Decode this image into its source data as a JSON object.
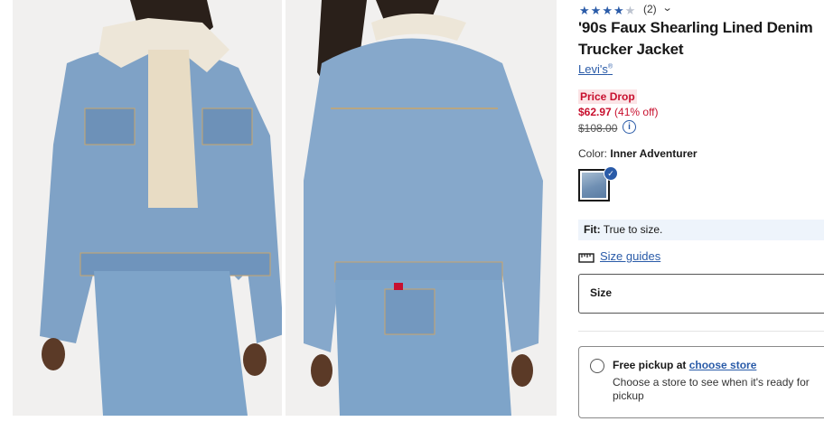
{
  "rating": {
    "stars": 4,
    "max": 5,
    "count": "(2)"
  },
  "product": {
    "title": "'90s Faux Shearling Lined Denim Trucker Jacket",
    "brand": "Levi's",
    "brand_mark": "®"
  },
  "pricing": {
    "badge": "Price Drop",
    "sale_price": "$62.97",
    "discount": "(41% off)",
    "original_price": "$108.00",
    "info_glyph": "i"
  },
  "color": {
    "label": "Color:",
    "value": "Inner Adventurer"
  },
  "fit": {
    "label": "Fit:",
    "value": "True to size."
  },
  "size_guides": "Size guides",
  "size": {
    "label": "Size"
  },
  "pickup": {
    "title": "Free pickup at",
    "link": "choose store",
    "subtitle": "Choose a store to see when it's ready for pickup"
  },
  "icons": [
    "star-icon",
    "chevron-down-icon",
    "info-icon",
    "checkmark-icon",
    "size-guide-icon",
    "radio-icon"
  ],
  "colors": {
    "accent": "#2a5ba8",
    "sale": "#c8102e",
    "fit_bg": "#eef4fb"
  }
}
